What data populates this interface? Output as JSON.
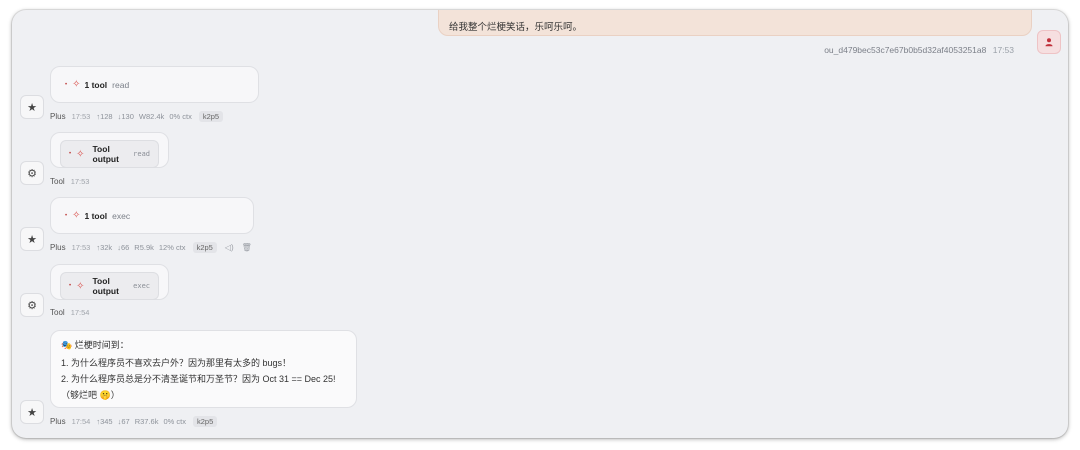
{
  "user_message": {
    "text": "给我整个烂梗笑话，乐呵乐呵。",
    "sender": "ou_d479bec53c7e67b0b5d32af4053251a8",
    "time": "17:53"
  },
  "blocks": [
    {
      "kind": "assistant",
      "tool_count": "1 tool",
      "tool_name": "read",
      "who": "Plus",
      "time": "17:53",
      "stats": [
        "↑128",
        "↓130",
        "W82.4k",
        "0% ctx"
      ],
      "model": "k2p5"
    },
    {
      "kind": "tool",
      "label": "Tool output",
      "code": "read",
      "who": "Tool",
      "time": "17:53"
    },
    {
      "kind": "assistant",
      "tool_count": "1 tool",
      "tool_name": "exec",
      "who": "Plus",
      "time": "17:53",
      "stats": [
        "↑32k",
        "↓66",
        "R5.9k",
        "12% ctx"
      ],
      "model": "k2p5"
    },
    {
      "kind": "tool",
      "label": "Tool output",
      "code": "exec",
      "who": "Tool",
      "time": "17:54"
    }
  ],
  "final": {
    "heading": "烂梗时间到：",
    "lines": [
      "1. 为什么程序员不喜欢去户外？因为那里有太多的 bugs！",
      "2. 为什么程序员总是分不清圣诞节和万圣节？因为 Oct 31 == Dec 25!",
      "（够烂吧 🤫）"
    ],
    "who": "Plus",
    "time": "17:54",
    "stats": [
      "↑345",
      "↓67",
      "R37.6k",
      "0% ctx"
    ],
    "model": "k2p5"
  },
  "icons": {
    "assistant_avatar": "star-icon",
    "tool_avatar": "gear-icon",
    "user_avatar": "person-icon",
    "tool_spark": "spark-icon",
    "speaker": "speaker-icon",
    "trash": "trash-icon"
  },
  "colors": {
    "user_bubble": "#f3e3d9",
    "accent": "#d9534f",
    "background": "#eff0f3"
  }
}
